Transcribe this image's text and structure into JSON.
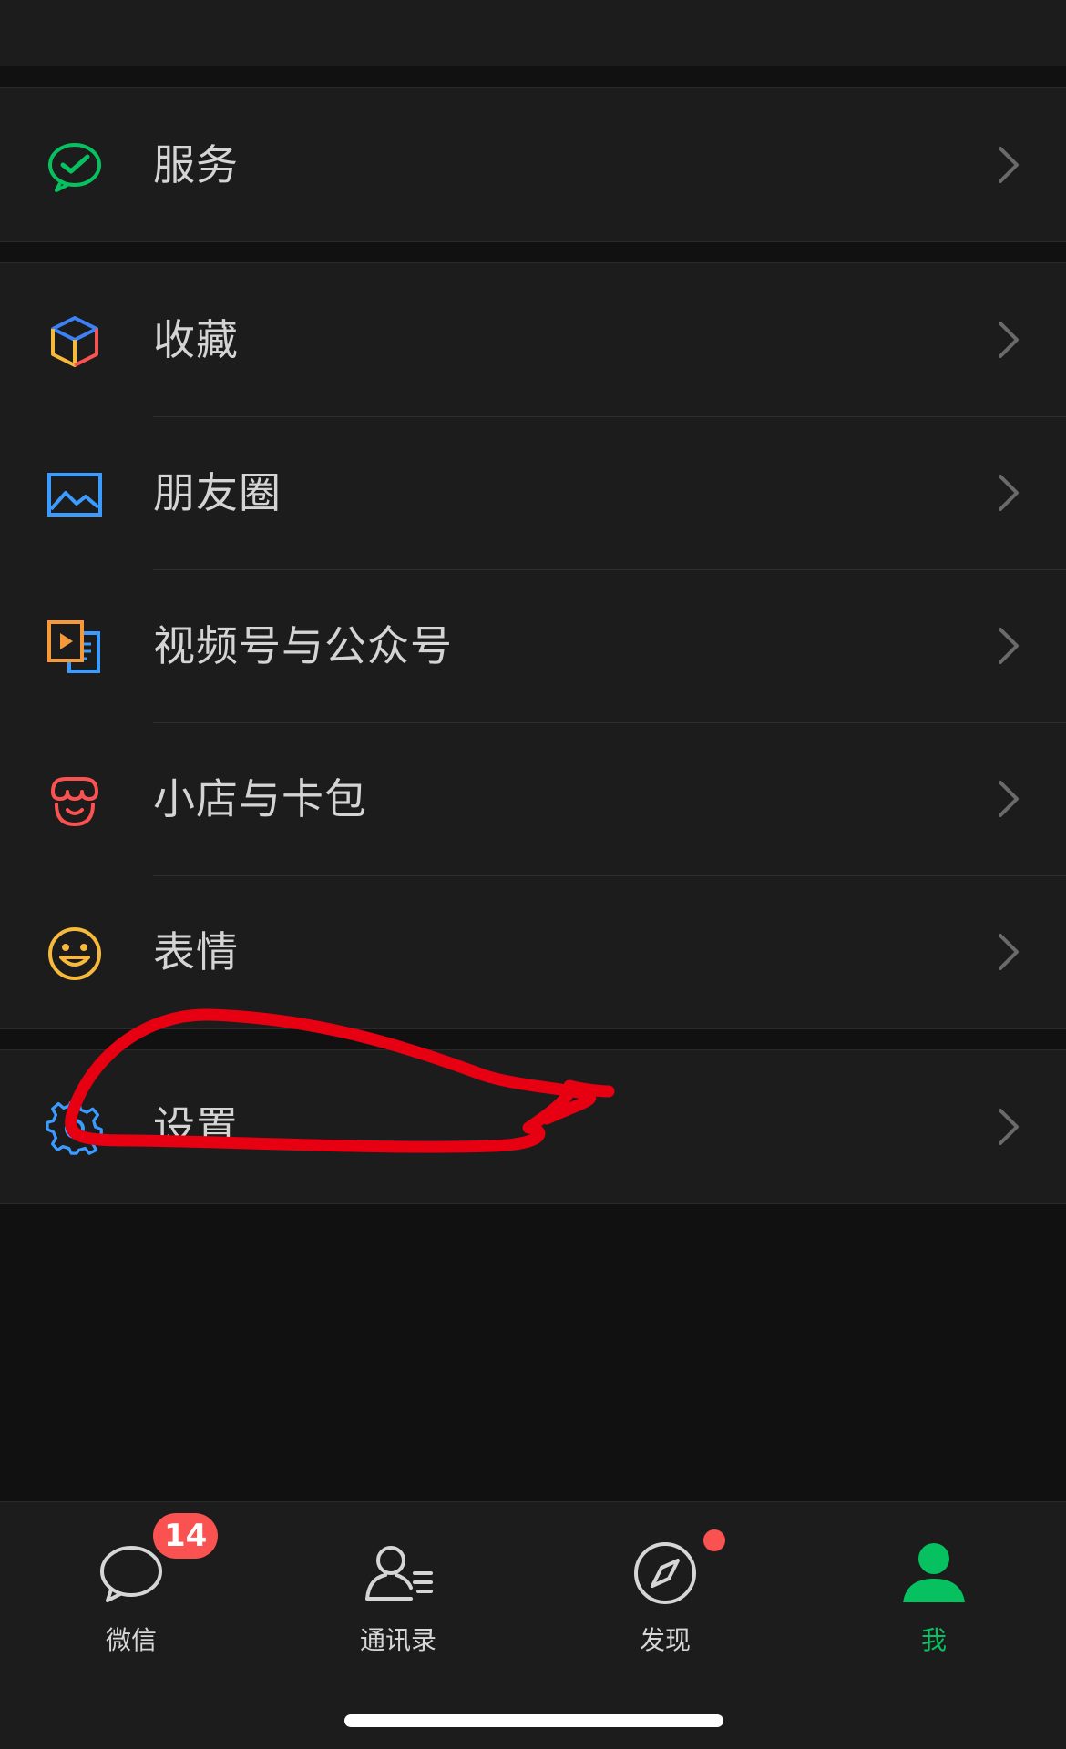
{
  "menu": {
    "services": {
      "label": "服务",
      "icon": "wechat-pay-check-icon",
      "color": "#07c160"
    },
    "favorites": {
      "label": "收藏",
      "icon": "cube-icon",
      "colors": [
        "#3b82f6",
        "#f6b93b",
        "#fa5151"
      ]
    },
    "moments": {
      "label": "朋友圈",
      "icon": "image-icon",
      "color": "#3b9bff"
    },
    "channels": {
      "label": "视频号与公众号",
      "icon": "video-play-icon",
      "colors": [
        "#f59a3b",
        "#3b9bff"
      ]
    },
    "shop": {
      "label": "小店与卡包",
      "icon": "shop-icon",
      "color": "#fa5151"
    },
    "stickers": {
      "label": "表情",
      "icon": "smile-icon",
      "color": "#f6b93b"
    },
    "settings": {
      "label": "设置",
      "icon": "gear-icon",
      "color": "#3b9bff"
    }
  },
  "annotation": {
    "color": "#e60012",
    "shape": "hand-drawn circle around settings row"
  },
  "tabbar": {
    "chats": {
      "label": "微信",
      "badge": "14",
      "icon": "chat-bubble-icon"
    },
    "contacts": {
      "label": "通讯录",
      "icon": "contacts-icon"
    },
    "discover": {
      "label": "发现",
      "icon": "compass-icon",
      "has_dot": true
    },
    "me": {
      "label": "我",
      "icon": "person-icon",
      "active": true,
      "color": "#07c160"
    }
  }
}
